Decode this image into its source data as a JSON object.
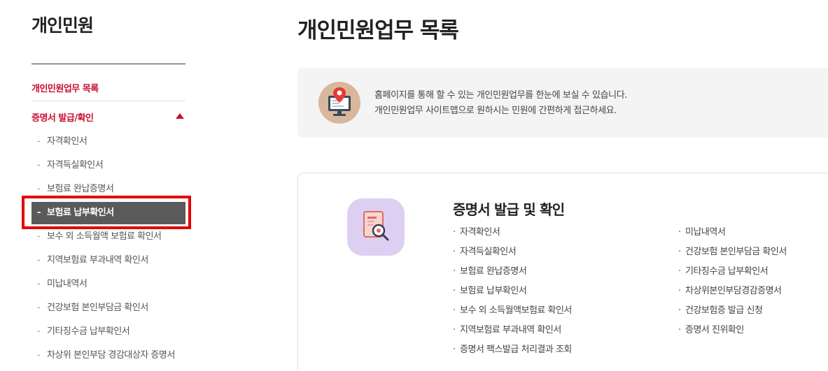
{
  "sidebar": {
    "title": "개인민원",
    "menu1": "개인민원업무 목록",
    "menu2": "증명서 발급/확인",
    "items": [
      {
        "label": "자격확인서"
      },
      {
        "label": "자격득실확인서"
      },
      {
        "label": "보험료 완납증명서"
      },
      {
        "label": "보험료 납부확인서",
        "active": true
      },
      {
        "label": "보수 외 소득월액 보험료 확인서"
      },
      {
        "label": "지역보험료 부과내역 확인서"
      },
      {
        "label": "미납내역서"
      },
      {
        "label": "건강보험 본인부담금 확인서"
      },
      {
        "label": "기타징수금 납부확인서"
      },
      {
        "label": "차상위 본인부담 경감대상자 증명서"
      }
    ],
    "dash": "-"
  },
  "main": {
    "title": "개인민원업무 목록",
    "notice": {
      "line1": "홈페이지를 통해 할 수 있는 개인민원업무를 한눈에 보실 수 있습니다.",
      "line2": "개인민원업무 사이트맵으로 원하시는 민원에 간편하게 접근하세요."
    },
    "section": {
      "title": "증명서 발급 및 확인",
      "bullet": "·",
      "left": [
        "자격확인서",
        "자격득실확인서",
        "보험료 완납증명서",
        "보험료 납부확인서",
        "보수 외 소득월액보험료 확인서",
        "지역보험료 부과내역 확인서",
        "증명서 팩스발급 처리결과 조회"
      ],
      "right": [
        "미납내역서",
        "건강보험 본인부담금 확인서",
        "기타징수금 납부확인서",
        "차상위본인부담경감증명서",
        "건강보험증 발급 신청",
        "증명서 진위확인"
      ]
    }
  },
  "icons": {
    "notice": "computer-location-pin-icon",
    "section": "document-magnifier-icon"
  },
  "colors": {
    "accent": "#c8102e",
    "active_bg": "#5a5a5a",
    "highlight": "#e60000"
  }
}
